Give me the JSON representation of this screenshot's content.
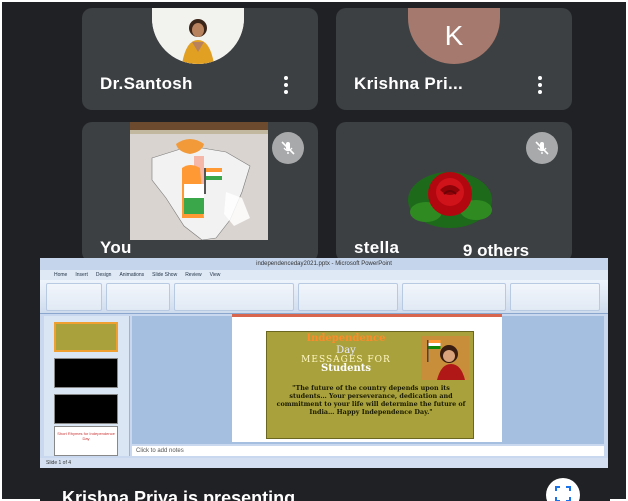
{
  "participants": [
    {
      "name": "Dr.Santosh",
      "avatar": "photo"
    },
    {
      "name": "Krishna Pri...",
      "avatar_letter": "K"
    },
    {
      "name": "You"
    },
    {
      "name": "stella"
    }
  ],
  "others_chip": "9 others",
  "presentation": {
    "window_title": "independenceday2021.pptx - Microsoft PowerPoint",
    "tabs": [
      "Home",
      "Insert",
      "Design",
      "Animations",
      "Slide Show",
      "Review",
      "View"
    ],
    "notes_placeholder": "Click to add notes",
    "status": "Slide 1 of 4",
    "thumbnail_caption": "Short Rhymes for Independence Day",
    "slide": {
      "heading_1": "Independence",
      "heading_2": "Day",
      "heading_3": "MESSAGES FOR",
      "heading_4": "Students",
      "quote": "\"The future of the country depends upon its students… Your perseverance, dedication and commitment to your life will determine the future of India… Happy Independence Day.\""
    }
  },
  "presenter_banner": "Krishna Priya is presenting",
  "colors": {
    "background": "#202124",
    "tile": "#3c4043",
    "avatar_k": "#a5796d"
  }
}
